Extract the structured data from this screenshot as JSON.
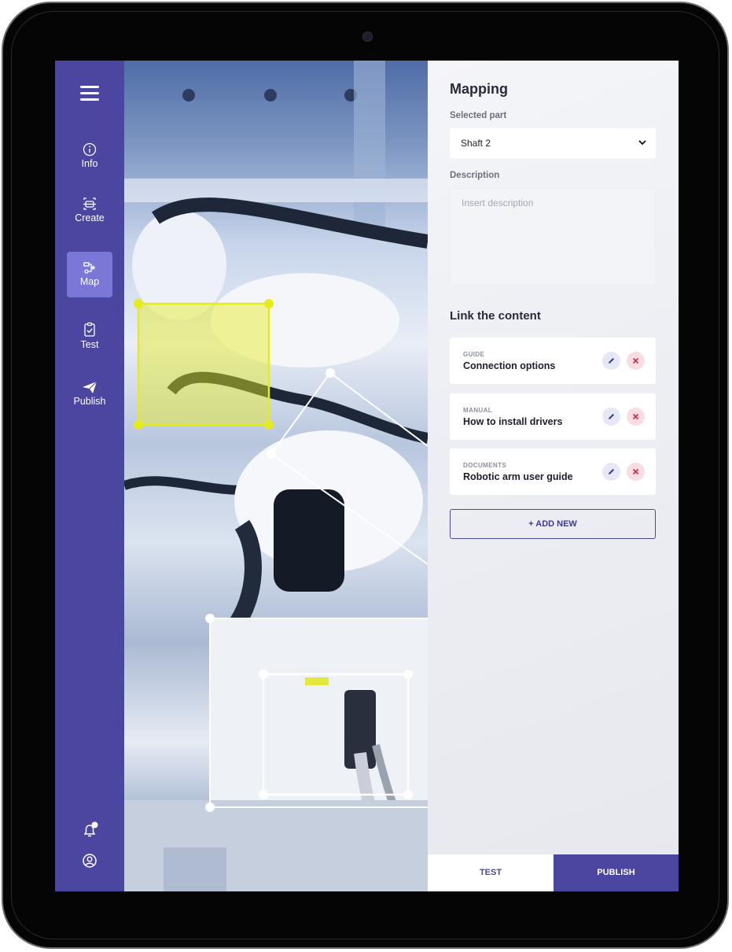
{
  "sidebar": {
    "items": [
      {
        "label": "Info",
        "icon": "info-icon"
      },
      {
        "label": "Create",
        "icon": "create-icon"
      },
      {
        "label": "Map",
        "icon": "map-icon",
        "active": true
      },
      {
        "label": "Test",
        "icon": "clipboard-check-icon"
      },
      {
        "label": "Publish",
        "icon": "send-icon"
      }
    ],
    "bottom_icons": [
      "notification-bell-icon",
      "user-account-icon"
    ]
  },
  "panel": {
    "title": "Mapping",
    "selected_part_label": "Selected part",
    "selected_part_value": "Shaft 2",
    "description_label": "Description",
    "description_placeholder": "Insert description",
    "link_title": "Link the content",
    "cards": [
      {
        "type": "GUIDE",
        "title": "Connection options"
      },
      {
        "type": "MANUAL",
        "title": "How to install drivers"
      },
      {
        "type": "DOCUMENTS",
        "title": "Robotic arm user guide"
      }
    ],
    "add_new_label": "+ ADD NEW"
  },
  "footer": {
    "test_label": "TEST",
    "publish_label": "PUBLISH"
  },
  "colors": {
    "sidebar": "#4b47a0",
    "active_nav": "#7a77d6",
    "highlight_box": "#e6ec1c",
    "edit_button_bg": "#e6e7f7",
    "delete_button_bg": "#f8dde3"
  }
}
